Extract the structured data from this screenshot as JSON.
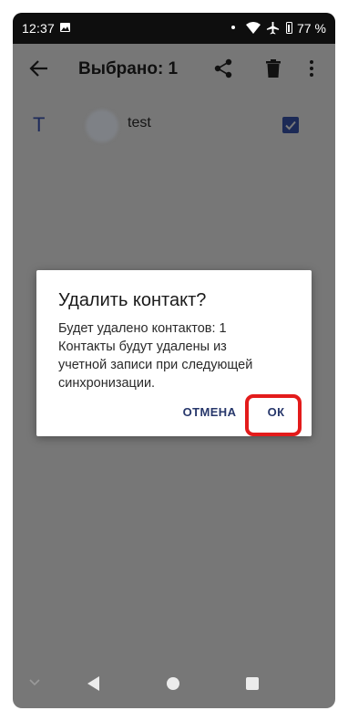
{
  "status_bar": {
    "time": "12:37",
    "battery_level": "77 %",
    "icons": [
      "image-icon",
      "dot-icon",
      "wifi-icon",
      "airplane-icon",
      "battery-icon"
    ]
  },
  "app_bar": {
    "title": "Выбрано: 1",
    "icons": [
      "back-arrow-icon",
      "share-icon",
      "trash-icon",
      "overflow-menu-icon"
    ]
  },
  "contact": {
    "letter": "T",
    "name": "test",
    "checked": true
  },
  "dialog": {
    "title": "Удалить контакт?",
    "message_lines": [
      "Будет удалено контактов: 1",
      "Контакты будут удалены из",
      "учетной записи при следующей",
      "синхронизации."
    ],
    "cancel_label": "ОТМЕНА",
    "ok_label": "ОК"
  },
  "colors": {
    "accent": "#27376b",
    "highlight": "#e31b1b",
    "scrim": "#777777"
  }
}
